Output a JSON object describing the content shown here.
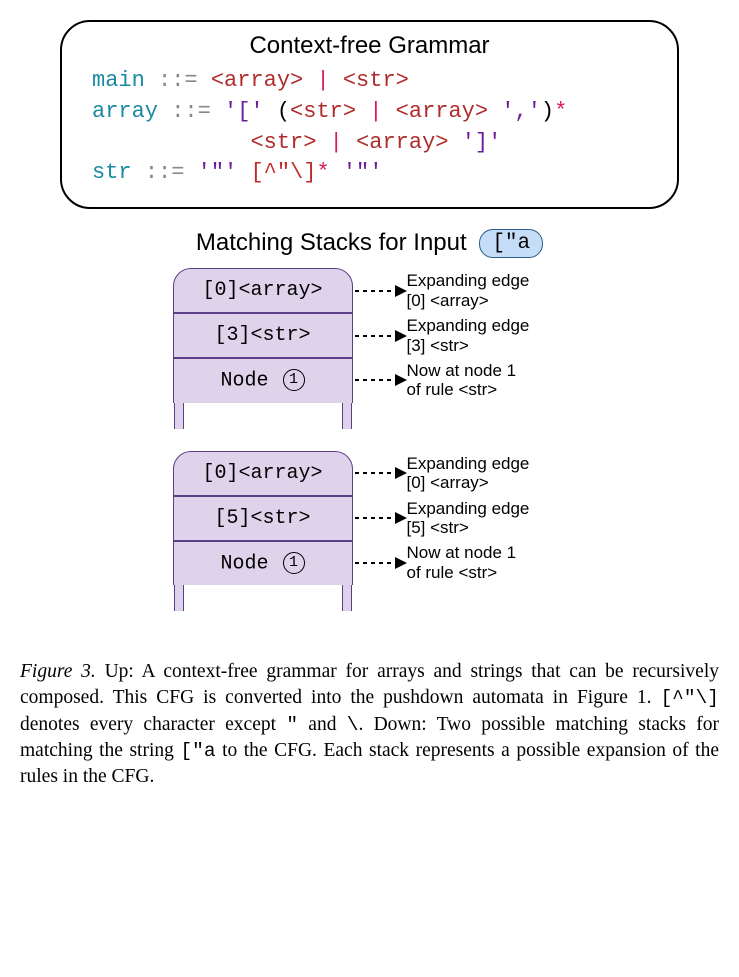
{
  "grammar": {
    "title": "Context-free Grammar",
    "lines": [
      {
        "html": "<span class='tk-rule'>main</span> <span class='tk-eq'>::=</span> <span class='tk-nt'>&lt;array&gt;</span> <span class='tk-op'>|</span> <span class='tk-nt'>&lt;str&gt;</span>"
      },
      {
        "html": "<span class='tk-rule'>array</span> <span class='tk-eq'>::=</span> <span class='tk-lit'>'['</span> (<span class='tk-nt'>&lt;str&gt;</span> <span class='tk-op'>|</span> <span class='tk-nt'>&lt;array&gt;</span> <span class='tk-lit'>','</span>)<span class='tk-op'>*</span>"
      },
      {
        "html": "            <span class='tk-nt'>&lt;str&gt;</span> <span class='tk-op'>|</span> <span class='tk-nt'>&lt;array&gt;</span> <span class='tk-lit'>']'</span>"
      },
      {
        "html": "<span class='tk-rule'>str</span> <span class='tk-eq'>::=</span> <span class='tk-lit'>'\"'</span> <span class='tk-regex'>[^\"\\]</span><span class='tk-op'>*</span> <span class='tk-lit'>'\"'</span>"
      }
    ]
  },
  "stacks": {
    "title_prefix": "Matching Stacks for Input",
    "input_chip": "[\"a",
    "groups": [
      {
        "rows": [
          {
            "cell_label": "[0]<array>",
            "desc_l1": "Expanding edge",
            "desc_l2": "[0] <array>"
          },
          {
            "cell_label": "[3]<str>",
            "desc_l1": "Expanding edge",
            "desc_l2": "[3] <str>"
          },
          {
            "cell_label": "Node",
            "circled": "1",
            "desc_l1": "Now at node 1",
            "desc_l2": "of rule <str>"
          }
        ]
      },
      {
        "rows": [
          {
            "cell_label": "[0]<array>",
            "desc_l1": "Expanding edge",
            "desc_l2": "[0] <array>"
          },
          {
            "cell_label": "[5]<str>",
            "desc_l1": "Expanding edge",
            "desc_l2": "[5] <str>"
          },
          {
            "cell_label": "Node",
            "circled": "1",
            "desc_l1": "Now at node 1",
            "desc_l2": "of rule <str>"
          }
        ]
      }
    ]
  },
  "caption": {
    "figure_label": "Figure 3.",
    "text_before_code1": " Up: A context-free grammar for arrays and strings that can be recursively composed. This CFG is converted into the pushdown automata in Figure 1. ",
    "code1": "[^\"\\]",
    "text_mid1": " denotes every character except ",
    "code2": "\"",
    "text_mid2": " and ",
    "code3": "\\",
    "text_mid3": ". Down: Two possible matching stacks for matching the string ",
    "code4": "[\"a",
    "text_after": " to the CFG. Each stack represents a possible expansion of the rules in the CFG."
  }
}
